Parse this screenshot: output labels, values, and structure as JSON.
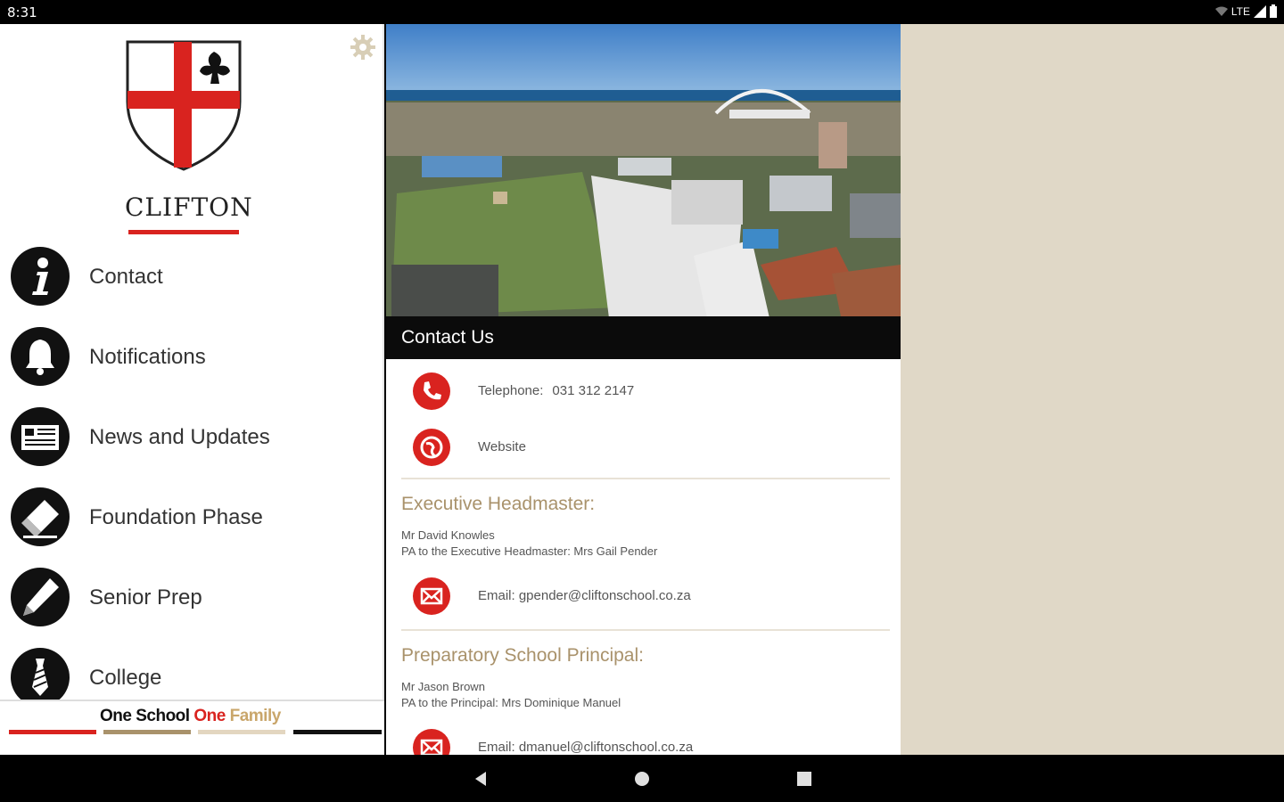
{
  "status_bar": {
    "time": "8:31",
    "network": "LTE"
  },
  "sidebar": {
    "brand": "CLIFTON",
    "menu": [
      {
        "label": "Contact",
        "icon": "info-icon"
      },
      {
        "label": "Notifications",
        "icon": "bell-icon"
      },
      {
        "label": "News and Updates",
        "icon": "newspaper-icon"
      },
      {
        "label": "Foundation Phase",
        "icon": "eraser-icon"
      },
      {
        "label": "Senior Prep",
        "icon": "pencil-icon"
      },
      {
        "label": "College",
        "icon": "tie-icon"
      }
    ],
    "tagline": {
      "part1": "One School",
      "part2": "One",
      "part3": "Family"
    }
  },
  "content": {
    "title": "Contact Us",
    "telephone_label": "Telephone:",
    "telephone_value": "031 312 2147",
    "website_label": "Website",
    "sections": [
      {
        "heading": "Executive Headmaster:",
        "name": "Mr David Knowles",
        "pa": "PA to the Executive Headmaster:  Mrs Gail Pender",
        "email": "Email: gpender@cliftonschool.co.za"
      },
      {
        "heading": "Preparatory School Principal:",
        "name": "Mr Jason Brown",
        "pa": "PA to the Principal:  Mrs Dominique Manuel",
        "email": "Email: dmanuel@cliftonschool.co.za"
      }
    ]
  },
  "colors": {
    "accent_red": "#d9231f",
    "gold": "#a9926b",
    "beige_pane": "#e0d8c7"
  }
}
